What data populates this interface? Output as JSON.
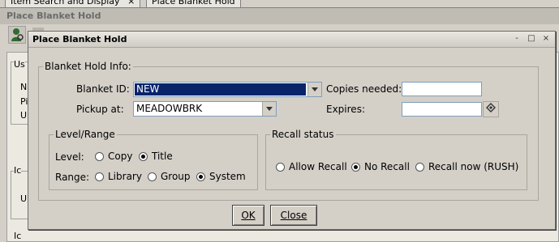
{
  "background": {
    "tabs": [
      "Item Search and Display",
      "Place Blanket Hold"
    ],
    "tab_close_glyph": "×",
    "window_title": "Place Blanket Hold",
    "fragments": [
      "Us",
      "N",
      "Pi",
      "U",
      "Ic",
      "U",
      "Ic"
    ]
  },
  "dialog": {
    "title": "Place Blanket Hold",
    "window_buttons": {
      "minimize": "-",
      "maximize": "□",
      "close": "×"
    },
    "blanket_group": {
      "legend": "Blanket Hold Info:",
      "blanket_id_label": "Blanket ID:",
      "blanket_id_value": "NEW",
      "pickup_label": "Pickup at:",
      "pickup_value": "MEADOWBRK",
      "copies_label": "Copies needed:",
      "copies_value": "",
      "expires_label": "Expires:",
      "expires_value": ""
    },
    "level_group": {
      "legend": "Level/Range",
      "level_label": "Level:",
      "level_options": [
        {
          "label": "Copy",
          "selected": false
        },
        {
          "label": "Title",
          "selected": true
        }
      ],
      "range_label": "Range:",
      "range_options": [
        {
          "label": "Library",
          "selected": false
        },
        {
          "label": "Group",
          "selected": false
        },
        {
          "label": "System",
          "selected": true
        }
      ]
    },
    "recall_group": {
      "legend": "Recall status",
      "options": [
        {
          "label": "Allow Recall",
          "selected": false
        },
        {
          "label": "No Recall",
          "selected": true
        },
        {
          "label": "Recall now (RUSH)",
          "selected": false
        }
      ]
    },
    "buttons": {
      "ok": "OK",
      "close": "Close"
    }
  },
  "icons": [
    "user-search-icon",
    "toolbar-icon",
    "calendar-icon",
    "chevron-down-icon"
  ],
  "colors": {
    "selection": "#0a246a",
    "dialog_bg": "#d4d0c8",
    "field_border": "#7f9db9"
  }
}
